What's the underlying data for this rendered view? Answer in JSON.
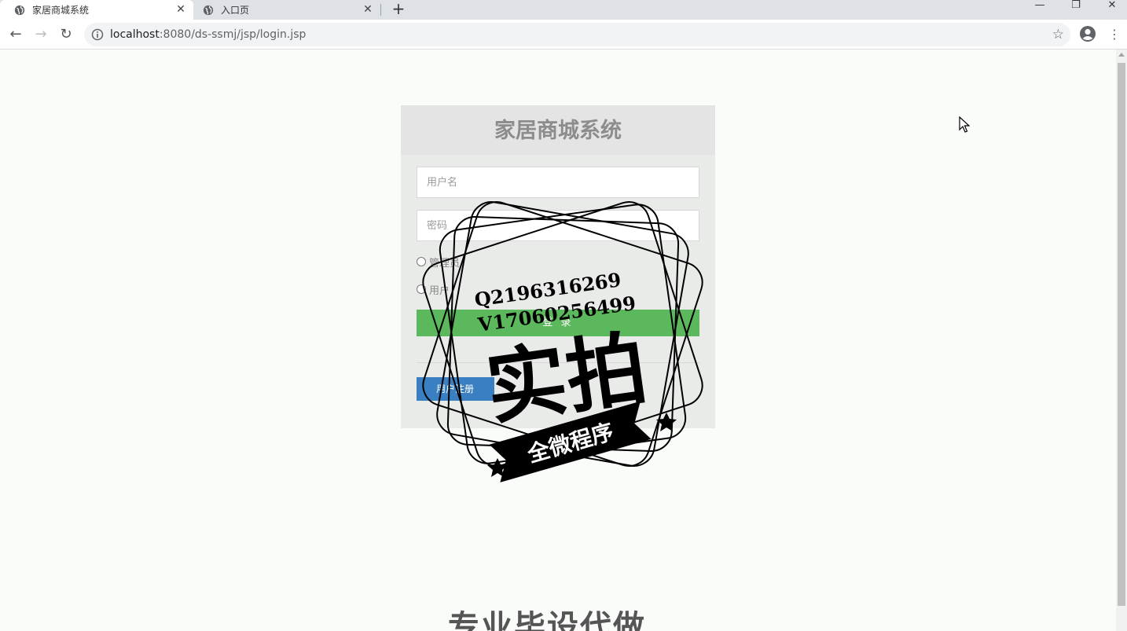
{
  "browser": {
    "tabs": [
      {
        "title": "家居商城系统",
        "active": true
      },
      {
        "title": "入口页",
        "active": false
      }
    ],
    "url_host": "localhost",
    "url_rest": ":8080/ds-ssmj/jsp/login.jsp"
  },
  "login": {
    "title": "家居商城系统",
    "username_placeholder": "用户名",
    "password_placeholder": "密码",
    "role_admin": "管理员",
    "role_user": "用户",
    "login_button": "登 录",
    "register_button": "用户注册"
  },
  "watermark": {
    "line1": "Q2196316269",
    "line2": "V17060256499",
    "big": "实拍",
    "banner": "全微程序"
  },
  "footer_text": "专业毕设代做",
  "colors": {
    "login_green": "#5cb85c",
    "register_blue": "#3a7fc1"
  }
}
